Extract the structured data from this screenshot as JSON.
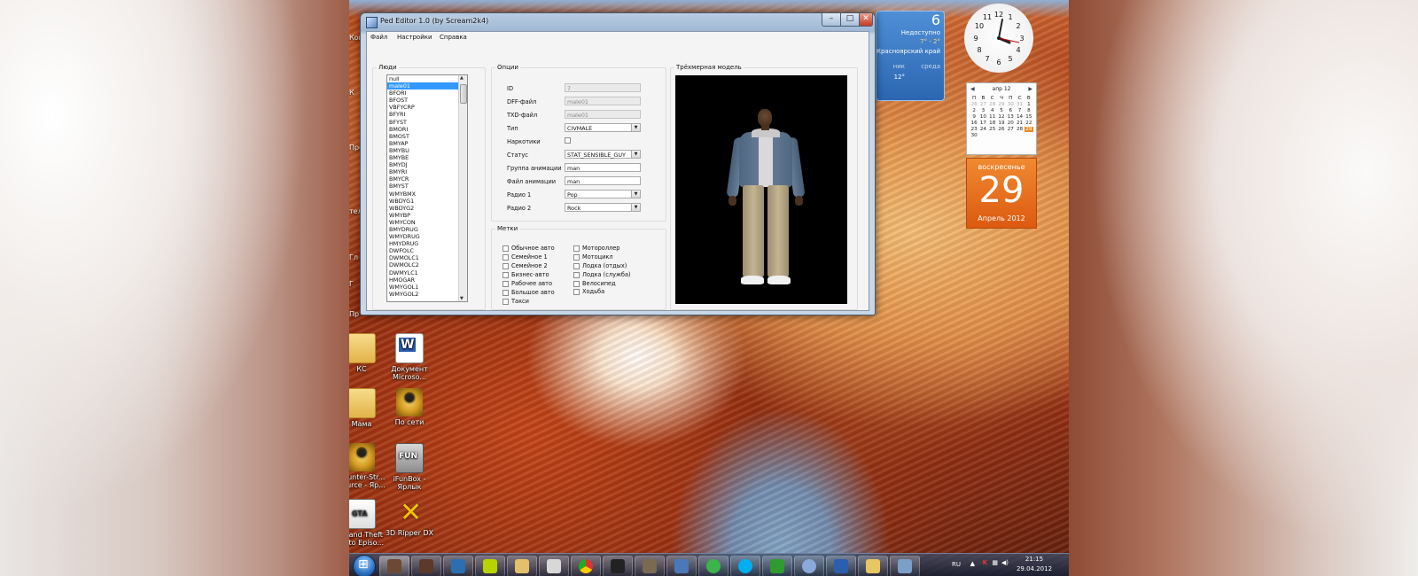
{
  "window": {
    "title": "Ped Editor 1.0 (by Scream2k4)",
    "menu": [
      "Файл",
      "Настройки",
      "Справка"
    ]
  },
  "people": {
    "title": "Люди",
    "selected_index": 1,
    "items": [
      "null",
      "male01",
      "BFORI",
      "BFOST",
      "VBFYCRP",
      "BFYRI",
      "BFYST",
      "BMORI",
      "BMOST",
      "BMYAP",
      "BMYBU",
      "BMYBE",
      "BMYDJ",
      "BMYRI",
      "BMYCR",
      "BMYST",
      "WMYBMX",
      "WBDYG1",
      "WBDYG2",
      "WMYBP",
      "WMYCON",
      "BMYDRUG",
      "WMYDRUG",
      "HMYDRUG",
      "DWFOLC",
      "DWMOLC1",
      "DWMOLC2",
      "DWMYLC1",
      "HMOGAR",
      "WMYGOL1",
      "WMYGOL2"
    ]
  },
  "options": {
    "title": "Опции",
    "id_label": "ID",
    "id_value": "7",
    "dff_label": "DFF-файл",
    "dff_value": "male01",
    "txd_label": "TXD-файл",
    "txd_value": "male01",
    "type_label": "Тип",
    "type_value": "CIVMALE",
    "drugs_label": "Наркотики",
    "status_label": "Статус",
    "status_value": "STAT_SENSIBLE_GUY",
    "animgroup_label": "Группа анимации",
    "animgroup_value": "man",
    "animfile_label": "Файл анимации",
    "animfile_value": "man",
    "radio1_label": "Радио 1",
    "radio1_value": "Pop",
    "radio2_label": "Радио 2",
    "radio2_value": "Rock"
  },
  "tags": {
    "title": "Метки",
    "left": [
      "Обычное авто",
      "Семейное 1",
      "Семейное 2",
      "Бизнес-авто",
      "Рабочее авто",
      "Большое авто",
      "Такси"
    ],
    "right": [
      "Мотороллер",
      "Мотоцикл",
      "Лодка (отдых)",
      "Лодка (служба)",
      "Велосипед"
    ],
    "walk": "Ходьба"
  },
  "model": {
    "title": "Трёхмерная модель"
  },
  "desktop": {
    "icons": [
      {
        "name": "folder-kc-icon",
        "label1": "КС",
        "label2": ""
      },
      {
        "name": "word-document-icon",
        "label1": "Документ",
        "label2": "Microso..."
      },
      {
        "name": "folder-mama-icon",
        "label1": "Мама",
        "label2": ""
      },
      {
        "name": "counter-strike-network-icon",
        "label1": "По сети",
        "label2": ""
      },
      {
        "name": "counter-strike-source-icon",
        "label1": "Counter-Str...",
        "label2": "Source - Яр..."
      },
      {
        "name": "ifunbox-icon",
        "label1": "iFunBox -",
        "label2": "Ярлык"
      },
      {
        "name": "gta-icon",
        "label1": "Grand Theft",
        "label2": "Auto Episo..."
      },
      {
        "name": "3d-ripper-icon",
        "label1": "3D Ripper DX",
        "label2": ""
      }
    ],
    "left_stubs": [
      "Ком",
      "К",
      "Про",
      "тел",
      "Гл",
      "Г",
      "Пр"
    ]
  },
  "weather": {
    "temp": "6",
    "line1": "Недоступно",
    "line2": "7° - 2°",
    "city": "Красноярский край",
    "temp2": "12°",
    "day": "ник",
    "day2": "среда"
  },
  "calendar": {
    "month": "апр 12",
    "weekdays": [
      "П",
      "В",
      "С",
      "Ч",
      "П",
      "С",
      "В"
    ],
    "days": [
      "26",
      "27",
      "28",
      "29",
      "30",
      "31",
      "1",
      "2",
      "3",
      "4",
      "5",
      "6",
      "7",
      "8",
      "9",
      "10",
      "11",
      "12",
      "13",
      "14",
      "15",
      "16",
      "17",
      "18",
      "19",
      "20",
      "21",
      "22",
      "23",
      "24",
      "25",
      "26",
      "27",
      "28",
      "29",
      "30"
    ],
    "today": "29"
  },
  "datecard": {
    "weekday": "воскресенье",
    "day": "29",
    "month_year": "Апрель 2012"
  },
  "tray": {
    "lang": "RU",
    "time": "21:15",
    "date": "29.04.2012"
  },
  "colors": {
    "accent": "#3399ff",
    "datecard": "#e8731c"
  }
}
